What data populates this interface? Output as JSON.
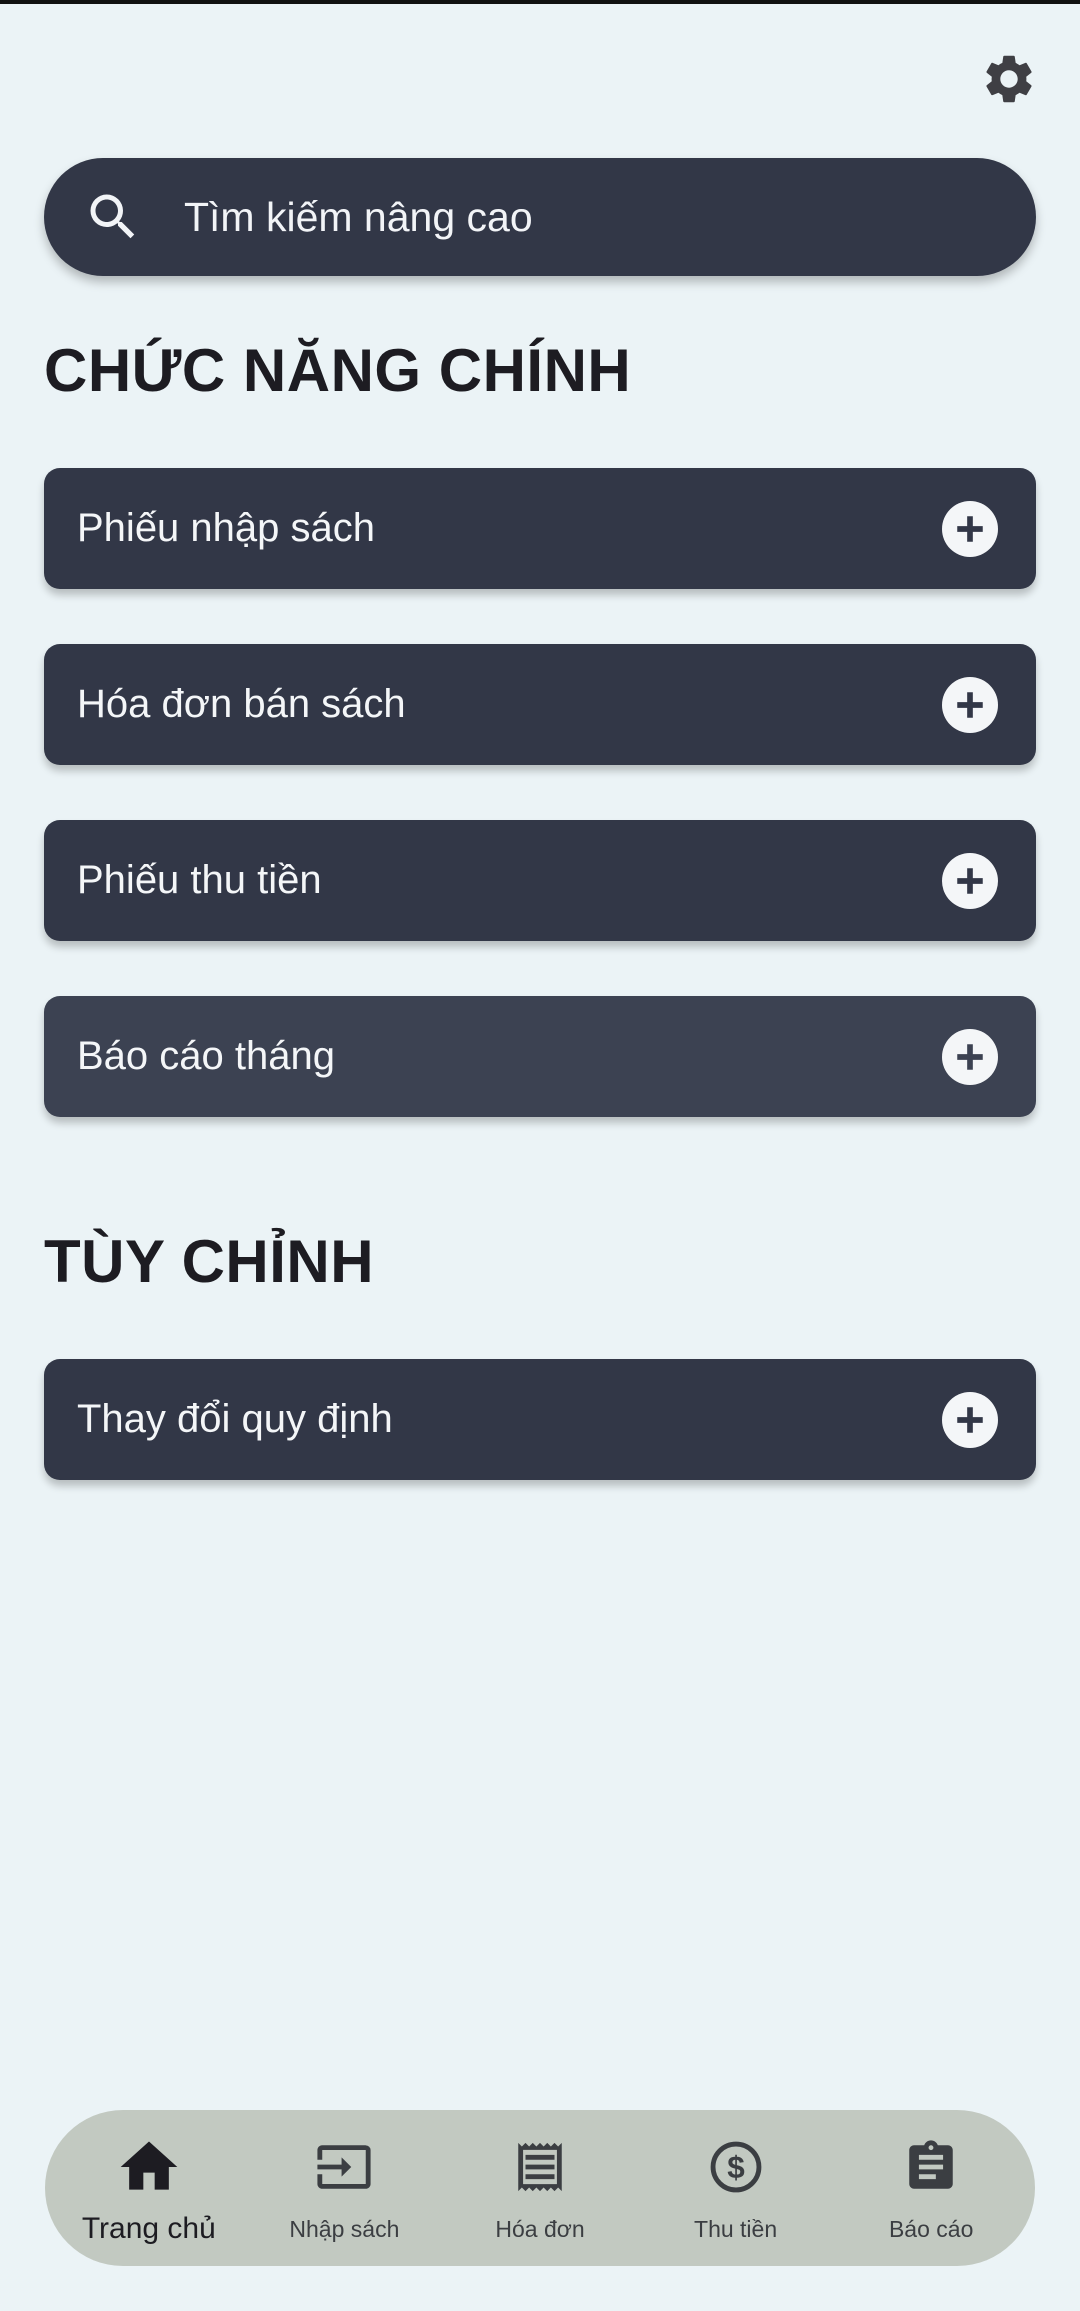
{
  "header": {
    "settings_icon": "gear-icon"
  },
  "search": {
    "placeholder": "Tìm kiếm nâng cao",
    "icon": "search-icon"
  },
  "main_section": {
    "title": "CHỨC NĂNG CHÍNH",
    "items": [
      {
        "label": "Phiếu nhập sách",
        "icon": "plus-icon"
      },
      {
        "label": "Hóa đơn bán sách",
        "icon": "plus-icon"
      },
      {
        "label": "Phiếu thu tiền",
        "icon": "plus-icon"
      },
      {
        "label": "Báo cáo tháng",
        "icon": "plus-icon"
      }
    ]
  },
  "custom_section": {
    "title": "TÙY CHỈNH",
    "items": [
      {
        "label": "Thay đổi quy định",
        "icon": "plus-icon"
      }
    ]
  },
  "bottom_nav": {
    "items": [
      {
        "label": "Trang chủ",
        "icon": "home-icon",
        "active": true
      },
      {
        "label": "Nhập sách",
        "icon": "import-icon",
        "active": false
      },
      {
        "label": "Hóa đơn",
        "icon": "receipt-icon",
        "active": false
      },
      {
        "label": "Thu tiền",
        "icon": "dollar-icon",
        "active": false
      },
      {
        "label": "Báo cáo",
        "icon": "clipboard-icon",
        "active": false
      }
    ]
  },
  "colors": {
    "background": "#EBF3F6",
    "card": "#323747",
    "card_alt": "#3C4252",
    "nav_bar": "#C2C9C1",
    "heading": "#1D1C22"
  }
}
